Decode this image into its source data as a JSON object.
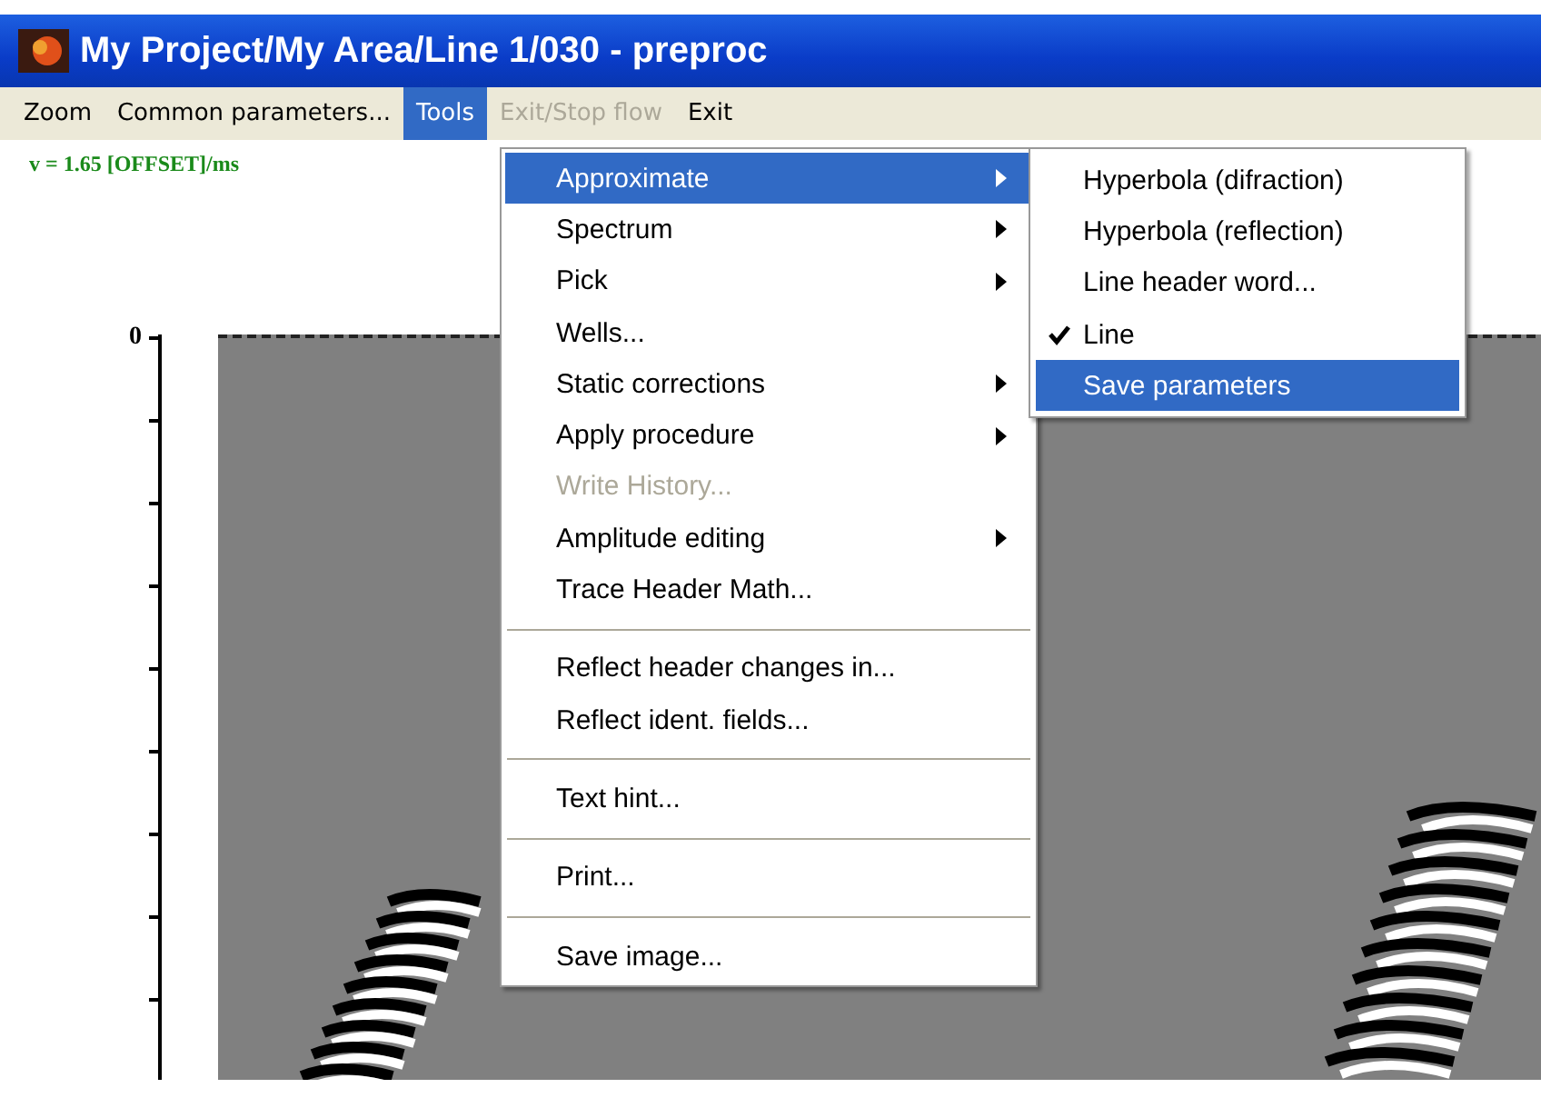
{
  "window": {
    "title": "My Project/My Area/Line 1/030 - preproc"
  },
  "menubar": [
    {
      "label": "Zoom",
      "selected": false,
      "disabled": false
    },
    {
      "label": "Common parameters...",
      "selected": false,
      "disabled": false
    },
    {
      "label": "Tools",
      "selected": true,
      "disabled": false
    },
    {
      "label": "Exit/Stop flow",
      "selected": false,
      "disabled": true
    },
    {
      "label": "Exit",
      "selected": false,
      "disabled": false
    }
  ],
  "velocity_label": "v = 1.65 [OFFSET]/ms",
  "axis": {
    "tick_label": "0"
  },
  "tools_menu": [
    {
      "kind": "item",
      "label": "Approximate",
      "submenu": true,
      "disabled": false,
      "selected": true
    },
    {
      "kind": "item",
      "label": "Spectrum",
      "submenu": true,
      "disabled": false,
      "selected": false
    },
    {
      "kind": "item",
      "label": "Pick",
      "submenu": true,
      "disabled": false,
      "selected": false
    },
    {
      "kind": "item",
      "label": "Wells...",
      "submenu": false,
      "disabled": false,
      "selected": false
    },
    {
      "kind": "item",
      "label": "Static corrections",
      "submenu": true,
      "disabled": false,
      "selected": false
    },
    {
      "kind": "item",
      "label": "Apply procedure",
      "submenu": true,
      "disabled": false,
      "selected": false
    },
    {
      "kind": "item",
      "label": "Write History...",
      "submenu": false,
      "disabled": true,
      "selected": false
    },
    {
      "kind": "item",
      "label": "Amplitude editing",
      "submenu": true,
      "disabled": false,
      "selected": false
    },
    {
      "kind": "item",
      "label": "Trace Header Math...",
      "submenu": false,
      "disabled": false,
      "selected": false
    },
    {
      "kind": "separator"
    },
    {
      "kind": "item",
      "label": "Reflect header changes in...",
      "submenu": false,
      "disabled": false,
      "selected": false
    },
    {
      "kind": "item",
      "label": "Reflect ident. fields...",
      "submenu": false,
      "disabled": false,
      "selected": false
    },
    {
      "kind": "separator"
    },
    {
      "kind": "item",
      "label": "Text hint...",
      "submenu": false,
      "disabled": false,
      "selected": false
    },
    {
      "kind": "separator"
    },
    {
      "kind": "item",
      "label": "Print...",
      "submenu": false,
      "disabled": false,
      "selected": false
    },
    {
      "kind": "separator"
    },
    {
      "kind": "item",
      "label": "Save image...",
      "submenu": false,
      "disabled": false,
      "selected": false
    }
  ],
  "approximate_submenu": [
    {
      "label": "Hyperbola (difraction)",
      "checked": false,
      "selected": false
    },
    {
      "label": "Hyperbola (reflection)",
      "checked": false,
      "selected": false
    },
    {
      "label": "Line header word...",
      "checked": false,
      "selected": false
    },
    {
      "label": "Line",
      "checked": true,
      "selected": false
    },
    {
      "label": "Save parameters",
      "checked": false,
      "selected": true
    }
  ]
}
